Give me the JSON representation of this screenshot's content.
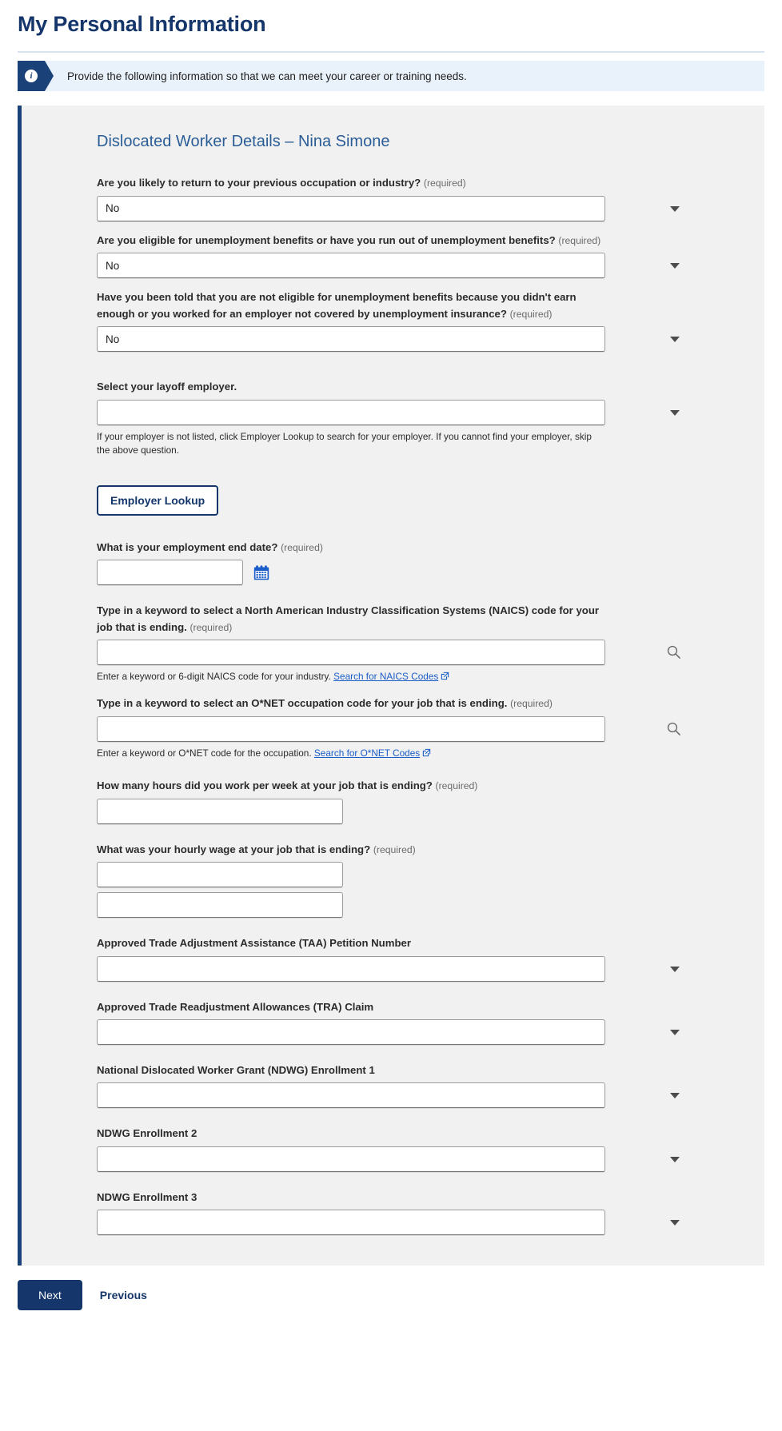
{
  "header": {
    "title": "My Personal Information"
  },
  "info_banner": {
    "icon": "info-icon",
    "message": "Provide the following information so that we can meet your career or training needs."
  },
  "form": {
    "section_title": "Dislocated Worker Details – Nina Simone",
    "required_tag": "(required)",
    "fields": [
      {
        "id": "return-to-occupation",
        "label": "Are you likely to return to your previous occupation or industry?",
        "required": true,
        "type": "select",
        "value": "No"
      },
      {
        "id": "eligible-unemployment-benefits",
        "label": "Are you eligible for unemployment benefits or have you run out of unemployment benefits?",
        "required": true,
        "type": "select",
        "value": "No"
      },
      {
        "id": "not-eligible-reason",
        "label": "Have you been told that you are not eligible for unemployment benefits because you didn't earn enough or you worked for an employer not covered by unemployment insurance?",
        "required": true,
        "type": "select",
        "value": "No"
      },
      {
        "id": "layoff-employer",
        "label": "Select your layoff employer.",
        "required": false,
        "type": "select",
        "value": "",
        "helper": "If your employer is not listed, click Employer Lookup to search for your employer. If you cannot find your employer, skip the above question."
      },
      {
        "id": "employment-end-date",
        "label": "What is your employment end date?",
        "required": true,
        "type": "date",
        "value": ""
      },
      {
        "id": "naics-code",
        "label": "Type in a keyword to select a North American Industry Classification Systems (NAICS) code for your job that is ending.",
        "required": true,
        "type": "search",
        "value": "",
        "helper_prefix": "Enter a keyword or 6-digit NAICS code for your industry.",
        "helper_link": "Search for NAICS Codes"
      },
      {
        "id": "onet-code",
        "label": "Type in a keyword to select an O*NET occupation code for your job that is ending.",
        "required": true,
        "type": "search",
        "value": "",
        "helper_prefix": "Enter a keyword or O*NET code for the occupation.",
        "helper_link": "Search for O*NET Codes"
      },
      {
        "id": "hours-per-week",
        "label": "How many hours did you work per week at your job that is ending?",
        "required": true,
        "type": "text",
        "value": ""
      },
      {
        "id": "hourly-wage",
        "label": "What was your hourly wage at your job that is ending?",
        "required": true,
        "type": "text-double",
        "value": "",
        "value2": ""
      },
      {
        "id": "taa-petition-number",
        "label": "Approved Trade Adjustment Assistance (TAA) Petition Number",
        "required": false,
        "type": "select",
        "value": ""
      },
      {
        "id": "tra-claim",
        "label": "Approved Trade Readjustment Allowances (TRA) Claim",
        "required": false,
        "type": "select",
        "value": ""
      },
      {
        "id": "ndwg-enrollment-1",
        "label": "National Dislocated Worker Grant (NDWG) Enrollment 1",
        "required": false,
        "type": "select",
        "value": ""
      },
      {
        "id": "ndwg-enrollment-2",
        "label": "NDWG Enrollment 2",
        "required": false,
        "type": "select",
        "value": ""
      },
      {
        "id": "ndwg-enrollment-3",
        "label": "NDWG Enrollment 3",
        "required": false,
        "type": "select",
        "value": ""
      }
    ],
    "employer_lookup_button": "Employer Lookup"
  },
  "footer": {
    "next_label": "Next",
    "previous_label": "Previous"
  },
  "colors": {
    "brand_navy": "#14366b",
    "panel_accent": "#1b4179",
    "section_title": "#2a5d96",
    "link_blue": "#1a5dc8",
    "banner_bg": "#e9f2fb",
    "panel_bg": "#f1f1f1"
  }
}
